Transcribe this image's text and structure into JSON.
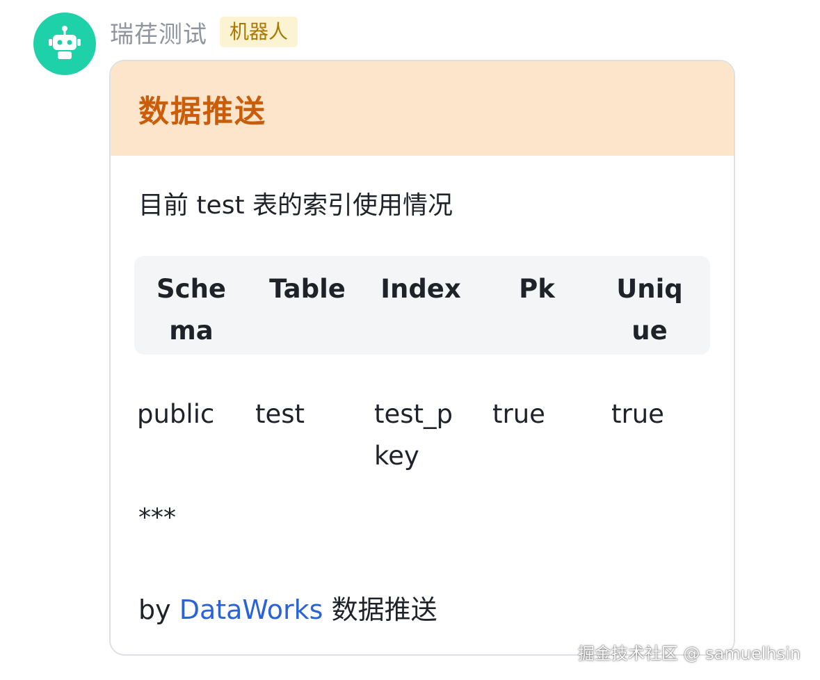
{
  "sender": {
    "name": "瑞荏测试",
    "badge": "机器人",
    "avatar_icon": "robot-icon",
    "avatar_color": "#1fd1a8"
  },
  "card": {
    "title": "数据推送",
    "header_color": "#fde5cc",
    "title_color": "#c95d0a",
    "intro": "目前 test 表的索引使用情况",
    "table": {
      "headers": [
        "Schema",
        "Table",
        "Index",
        "Pk",
        "Unique"
      ],
      "rows": [
        [
          "public",
          "test",
          "test_pkey",
          "true",
          "true"
        ]
      ]
    },
    "divider": "***",
    "footer": {
      "prefix": "by",
      "link": "DataWorks",
      "suffix": "数据推送",
      "link_color": "#2a63d8"
    }
  },
  "watermark": "掘金技术社区 @ samuelhsin"
}
